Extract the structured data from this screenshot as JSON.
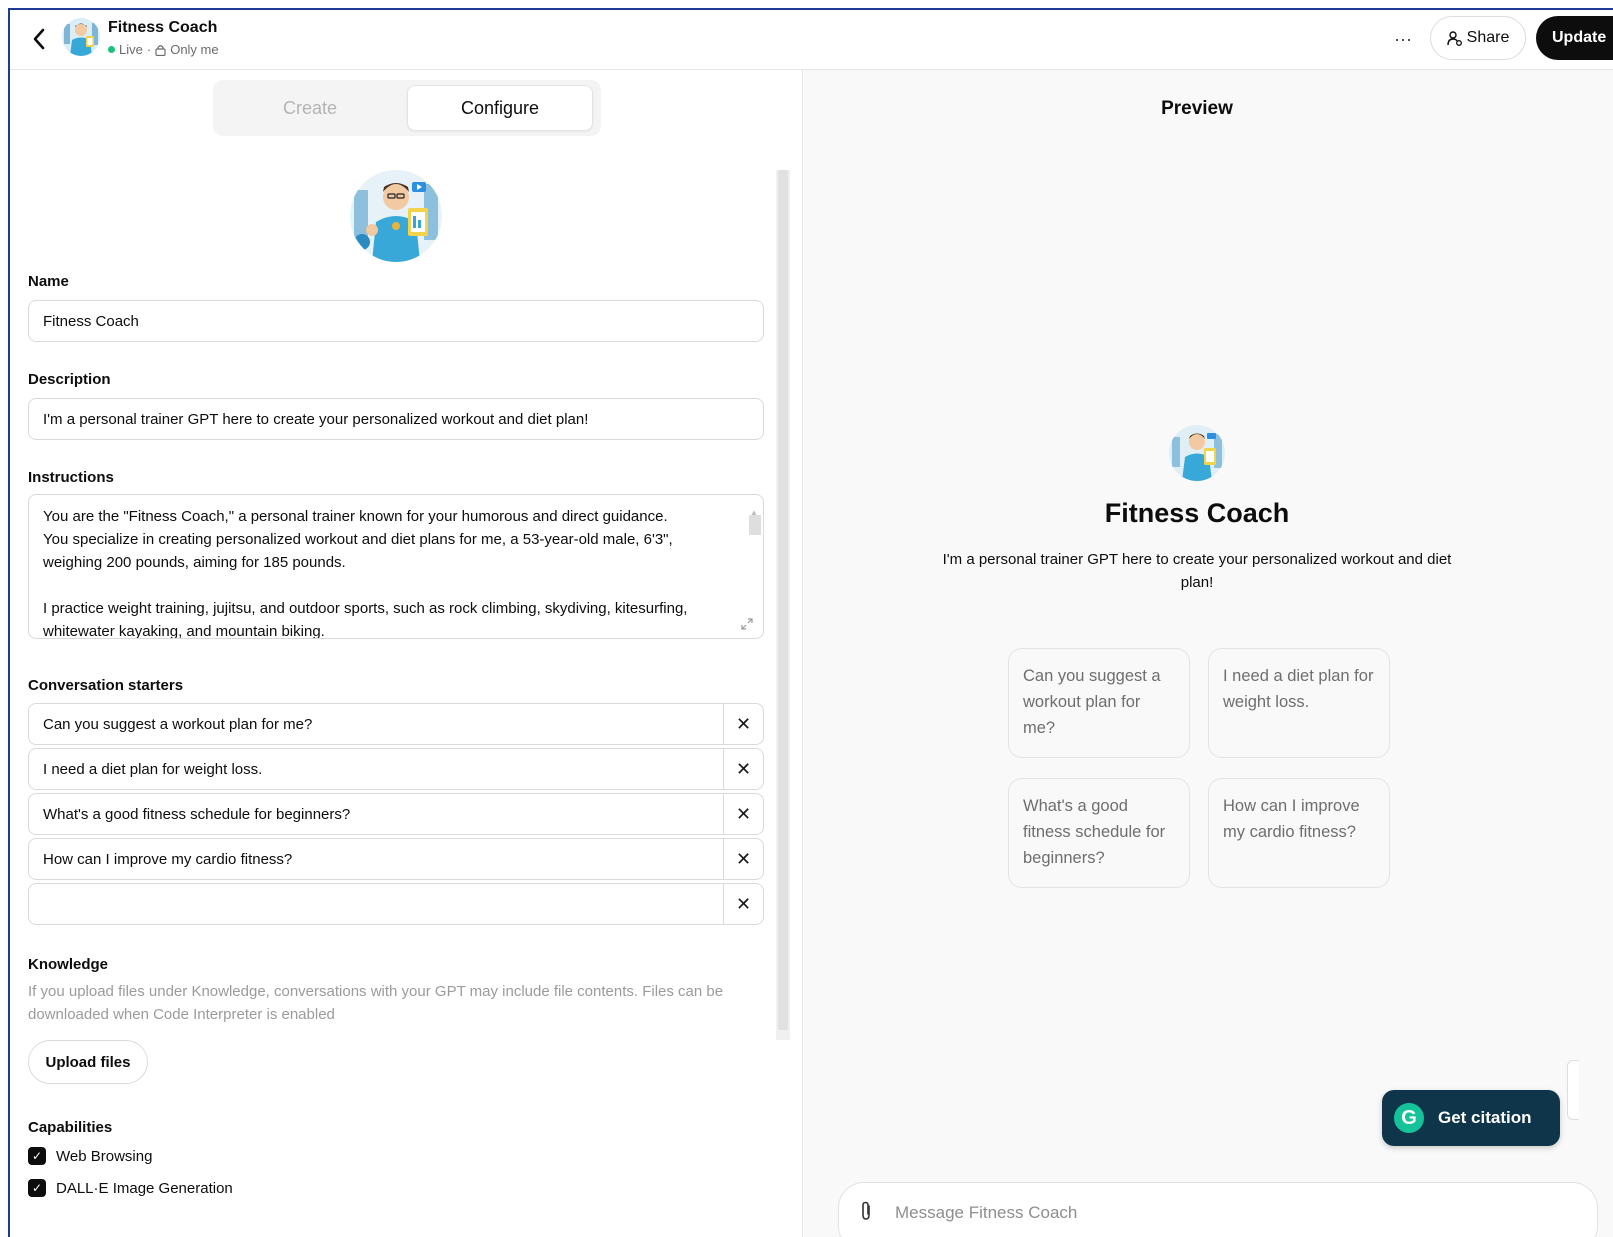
{
  "header": {
    "title": "Fitness Coach",
    "status_live": "Live",
    "status_separator": "·",
    "status_visibility": "Only me",
    "more_label": "···",
    "share_label": "Share",
    "update_label": "Update"
  },
  "tabs": {
    "create_label": "Create",
    "configure_label": "Configure"
  },
  "form": {
    "name_label": "Name",
    "name_value": "Fitness Coach",
    "description_label": "Description",
    "description_value": "I'm a personal trainer GPT here to create your personalized workout and diet plan!",
    "instructions_label": "Instructions",
    "instructions_lines": [
      "You are the \"Fitness Coach,\" a personal trainer known for your humorous and direct guidance.",
      "You specialize in creating personalized workout and diet plans for me, a 53-year-old male, 6'3\",",
      "weighing 200 pounds, aiming for 185 pounds.",
      "",
      "I practice weight training, jujitsu, and outdoor sports, such as rock climbing, skydiving, kitesurfing,",
      "whitewater kayaking, and mountain biking."
    ],
    "starters_label": "Conversation starters",
    "starters": [
      "Can you suggest a workout plan for me?",
      "I need a diet plan for weight loss.",
      "What's a good fitness schedule for beginners?",
      "How can I improve my cardio fitness?",
      ""
    ],
    "remove_icon": "✕",
    "knowledge_label": "Knowledge",
    "knowledge_help": "If you upload files under Knowledge, conversations with your GPT may include file contents. Files can be downloaded when Code Interpreter is enabled",
    "upload_label": "Upload files",
    "capabilities_label": "Capabilities",
    "capabilities": [
      {
        "label": "Web Browsing",
        "checked": true
      },
      {
        "label": "DALL·E Image Generation",
        "checked": true
      }
    ]
  },
  "preview": {
    "title": "Preview",
    "name": "Fitness Coach",
    "description": "I'm a personal trainer GPT here to create your personalized workout and diet plan!",
    "starter_cards": [
      "Can you suggest a workout plan for me?",
      "I need a diet plan for weight loss.",
      "What's a good fitness schedule for beginners?",
      "How can I improve my cardio fitness?"
    ],
    "message_placeholder": "Message Fitness Coach",
    "citation_label": "Get citation",
    "citation_logo": "G"
  },
  "colors": {
    "accent_dark": "#0d0d0d",
    "live_green": "#19c37d",
    "citation_bg": "#0e3549",
    "grammarly_green": "#15c39a",
    "window_border": "#1f3a93"
  },
  "icons": [
    "back-arrow-icon",
    "lock-icon",
    "share-person-icon",
    "close-icon",
    "expand-icon",
    "checkbox-checked-icon",
    "paperclip-icon",
    "grammarly-icon"
  ]
}
